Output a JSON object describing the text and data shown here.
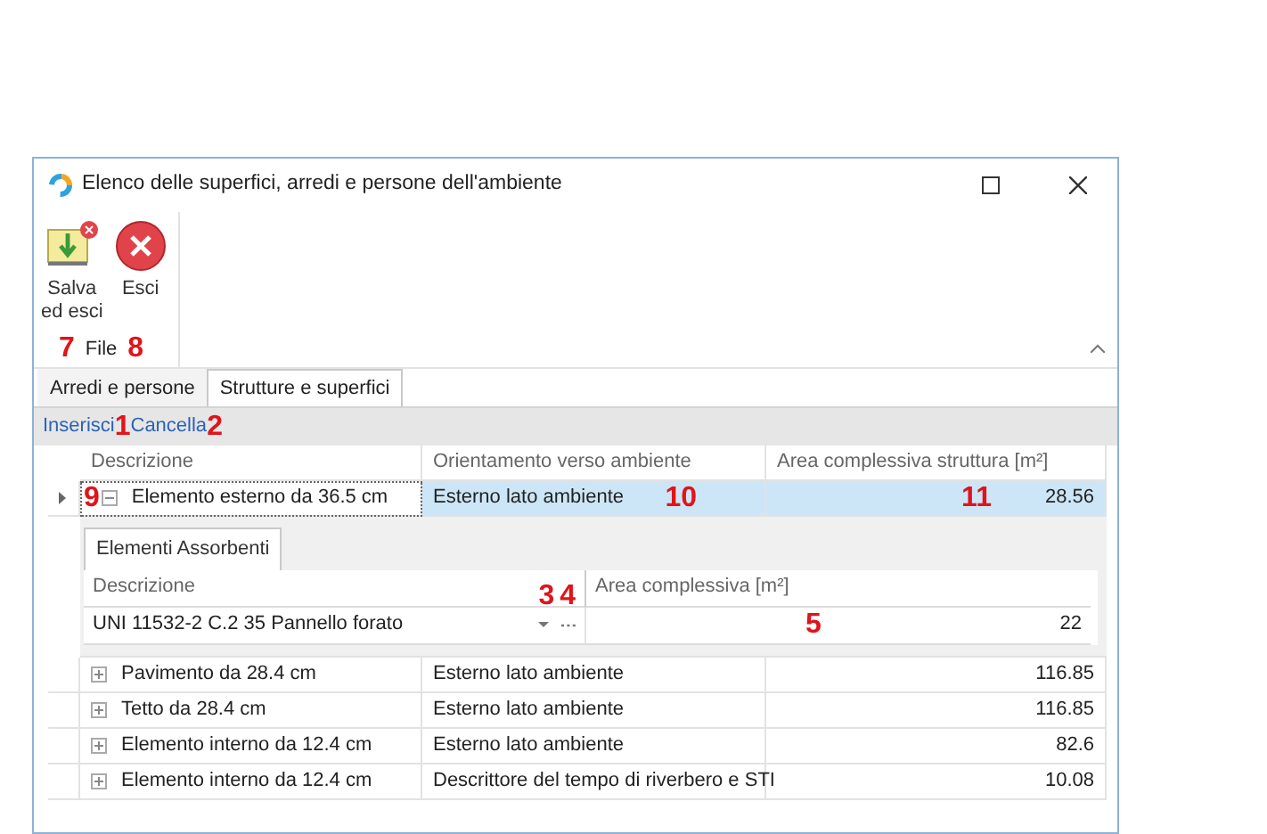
{
  "window": {
    "title": "Elenco delle superfici, arredi e persone dell'ambiente"
  },
  "ribbon": {
    "buttons": [
      {
        "kind": "save",
        "lines": [
          "Salva",
          "ed esci"
        ]
      },
      {
        "kind": "exit",
        "lines": [
          "Esci"
        ]
      }
    ],
    "group": "File",
    "group_callouts": [
      "7",
      "8"
    ]
  },
  "tabs": [
    {
      "label": "Arredi e persone",
      "selected": false
    },
    {
      "label": "Strutture e superfici",
      "selected": true
    }
  ],
  "actions": [
    {
      "label": "Inserisci",
      "callout": "1"
    },
    {
      "label": "Cancella",
      "callout": "2"
    }
  ],
  "grid": {
    "columns": [
      "Descrizione",
      "Orientamento verso ambiente",
      "Area complessiva struttura [m²]"
    ],
    "rows": [
      {
        "description": "Elemento esterno da 36.5 cm",
        "orientation": "Esterno lato ambiente",
        "area": "28.56",
        "expanded": true,
        "selected": true,
        "description_callout": "9",
        "orientation_callout": "10",
        "area_callout": "11",
        "detail": {
          "tab": "Elementi Assorbenti",
          "columns": [
            "Descrizione",
            "Area complessiva [m²]"
          ],
          "header_callouts": [
            "3",
            "4"
          ],
          "rows": [
            {
              "description": "UNI 11532-2 C.2 35 Pannello forato",
              "area": "22",
              "area_callout": "5"
            }
          ]
        }
      },
      {
        "description": "Pavimento da 28.4 cm",
        "orientation": "Esterno lato ambiente",
        "area": "116.85",
        "expanded": false,
        "selected": false
      },
      {
        "description": "Tetto da 28.4 cm",
        "orientation": "Esterno lato ambiente",
        "area": "116.85",
        "expanded": false,
        "selected": false
      },
      {
        "description": "Elemento interno da 12.4 cm",
        "orientation": "Esterno lato ambiente",
        "area": "82.6",
        "expanded": false,
        "selected": false
      },
      {
        "description": "Elemento interno da 12.4 cm",
        "orientation": "Descrittore del tempo di riverbero e STI",
        "area": "10.08",
        "expanded": false,
        "selected": false
      }
    ]
  }
}
